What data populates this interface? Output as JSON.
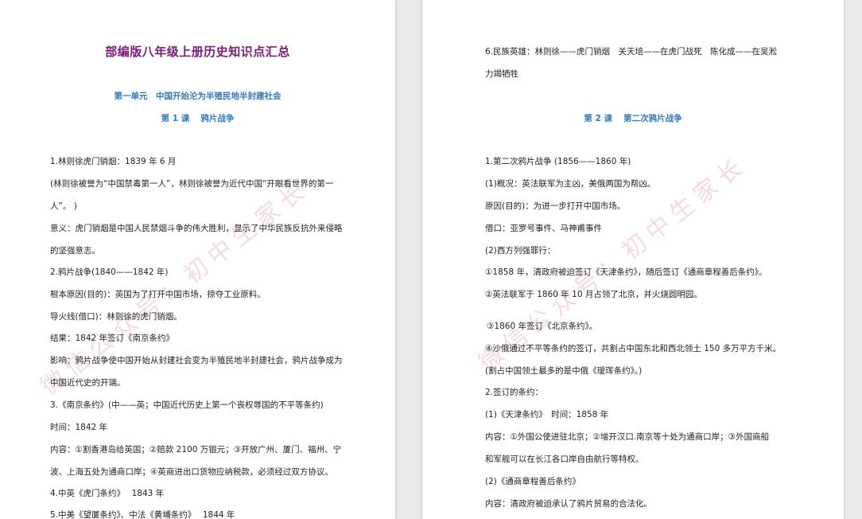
{
  "left_page": {
    "doc_title": "部编版八年级上册历史知识点汇总",
    "unit_title": "第一单元　中国开始沦为半殖民地半封建社会",
    "lesson_title": "第 1 课　 鸦片战争",
    "lines": [
      "1.林则徐虎门销烟：1839 年 6 月",
      "(林则徐被誉为“中国禁毒第一人”，林则徐被誉为近代中国“开眼看世界的第一",
      "人”。 )",
      "意义：虎门销烟是中国人民禁烟斗争的伟大胜利，显示了中华民族反抗外来侵略",
      "的坚强意志。",
      "2.鸦片战争(1840——1842 年)",
      "根本原因(目的)：英国为了打开中国市场，掠夺工业原料。",
      "导火线(借口)：林则徐的虎门销烟。",
      "结果：1842 年签订《南京条约》",
      "影响：鸦片战争使中国开始从封建社会变为半殖民地半封建社会，鸦片战争成为",
      "中国近代史的开端。",
      "3.《南京条约》(中——英；中国近代历史上第一个丧权辱国的不平等条约)",
      "时间：1842 年",
      "内容：①割香港岛给英国；②赔款 2100 万银元；③开放广州、厦门、福州、宁",
      "波、上海五处为通商口岸；④英商进出口货物应纳税款，必须经过双方协议。",
      "4.中英《虎门条约》　 1843 年",
      "5.中美《望厦条约》、中法《黄埔条约》　 1844 年"
    ],
    "watermark": "微信公众号：初中生家长"
  },
  "right_page": {
    "lines_top": [
      "6.民族英雄：林则徐——虎门销烟　关天培——在虎门战死　陈化成——在吴淞",
      "力竭牺牲"
    ],
    "lesson_title": "第 2 课　 第二次鸦片战争",
    "lines": [
      "1.第二次鸦片战争 (1856——1860 年)",
      "(1)概况：英法联军为主凶，美俄两国为帮凶。",
      "原因(目的)：为进一步打开中国市场。",
      "借口：亚罗号事件、马神甫事件",
      "(2)西方列强罪行：",
      "①1858 年，清政府被迫签订《天津条约》，随后签订《通商章程善后条约》。",
      "②英法联军于 1860 年 10 月占领了北京，并火烧圆明园。",
      "③1860 年签订《北京条约》。",
      "④沙俄通过不平等条约的签订，共割占中国东北和西北领土 150 多万平方千米。",
      "(割占中国领土最多的是中俄《瑷珲条约》。)",
      "2.签订的条约：",
      "(1)《天津条约》　时间：1858 年",
      "内容：①外国公使进驻北京；②增开汉口.南京等十处为通商口岸；③外国商船",
      "和军舰可以在长江各口岸自由航行等特权。",
      "(2)《通商章程善后条约》",
      "内容：清政府被迫承认了鸦片贸易的合法化。"
    ],
    "watermark": "微信公众号：初中生家长"
  }
}
